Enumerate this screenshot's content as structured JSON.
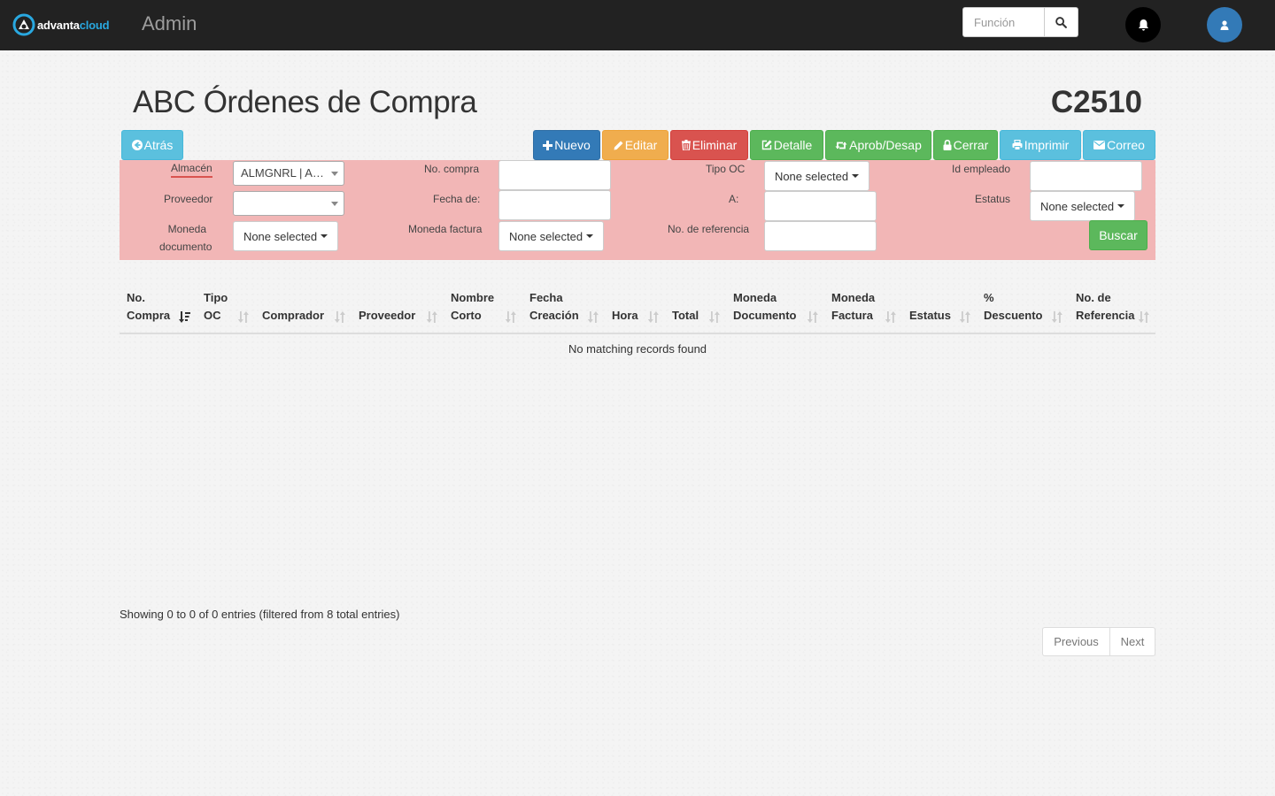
{
  "navbar": {
    "logo_prefix": "advanta",
    "logo_suffix": "cloud",
    "title": "Admin",
    "search_placeholder": "Función",
    "search_icon": "search-icon",
    "bell_icon": "bell-icon",
    "user_icon": "user-icon"
  },
  "page": {
    "title": "ABC Órdenes de Compra",
    "code": "C2510"
  },
  "toolbar": {
    "back": "Atrás",
    "new": "Nuevo",
    "edit": "Editar",
    "delete": "Eliminar",
    "detail": "Detalle",
    "approve": "Aprob/Desap",
    "close": "Cerrar",
    "print": "Imprimir",
    "mail": "Correo"
  },
  "filters": {
    "almacen_label": "Almacén",
    "almacen_value": "ALMGNRL | Almacén General",
    "proveedor_label": "Proveedor",
    "proveedor_value": "",
    "moneda_doc_label_1": "Moneda",
    "moneda_doc_label_2": "documento",
    "moneda_doc_value": "None selected",
    "no_compra_label": "No. compra",
    "fecha_de_label": "Fecha de:",
    "moneda_factura_label": "Moneda factura",
    "moneda_factura_value": "None selected",
    "tipo_oc_label": "Tipo OC",
    "tipo_oc_value": "None selected",
    "a_label": "A:",
    "no_referencia_label": "No. de referencia",
    "id_empleado_label": "Id empleado",
    "estatus_label": "Estatus",
    "estatus_value": "None selected",
    "search_button": "Buscar"
  },
  "table": {
    "columns": [
      {
        "l1": "No.",
        "l2": "Compra"
      },
      {
        "l1": "Tipo",
        "l2": "OC"
      },
      {
        "l1": "",
        "l2": "Comprador"
      },
      {
        "l1": "",
        "l2": "Proveedor"
      },
      {
        "l1": "Nombre",
        "l2": "Corto"
      },
      {
        "l1": "Fecha",
        "l2": "Creación"
      },
      {
        "l1": "",
        "l2": "Hora"
      },
      {
        "l1": "",
        "l2": "Total"
      },
      {
        "l1": "Moneda",
        "l2": "Documento"
      },
      {
        "l1": "Moneda",
        "l2": "Factura"
      },
      {
        "l1": "",
        "l2": "Estatus"
      },
      {
        "l1": "%",
        "l2": "Descuento"
      },
      {
        "l1": "No. de",
        "l2": "Referencia"
      }
    ],
    "empty_message": "No matching records found",
    "info": "Showing 0 to 0 of 0 entries (filtered from 8 total entries)",
    "prev": "Previous",
    "next": "Next"
  }
}
